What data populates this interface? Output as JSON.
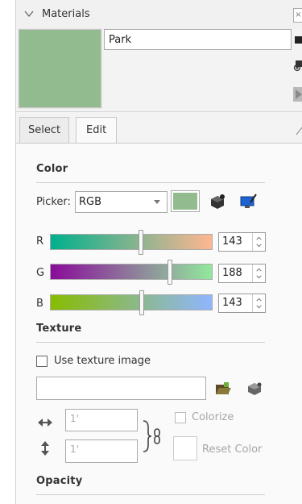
{
  "header": {
    "title": "Materials",
    "name_value": "Park"
  },
  "tabs": [
    {
      "label": "Select"
    },
    {
      "label": "Edit"
    }
  ],
  "color": {
    "section_label": "Color",
    "picker_label": "Picker:",
    "picker_value": "RGB",
    "swatch_hex": "#92BC8F",
    "channels": [
      {
        "label": "R",
        "value": "143",
        "fraction": 0.561
      },
      {
        "label": "G",
        "value": "188",
        "fraction": 0.737
      },
      {
        "label": "B",
        "value": "143",
        "fraction": 0.561
      }
    ]
  },
  "texture": {
    "section_label": "Texture",
    "use_texture_label": "Use texture image",
    "path_value": "",
    "width_value": "1'",
    "height_value": "1'",
    "colorize_label": "Colorize",
    "reset_label": "Reset Color"
  },
  "opacity": {
    "section_label": "Opacity"
  }
}
